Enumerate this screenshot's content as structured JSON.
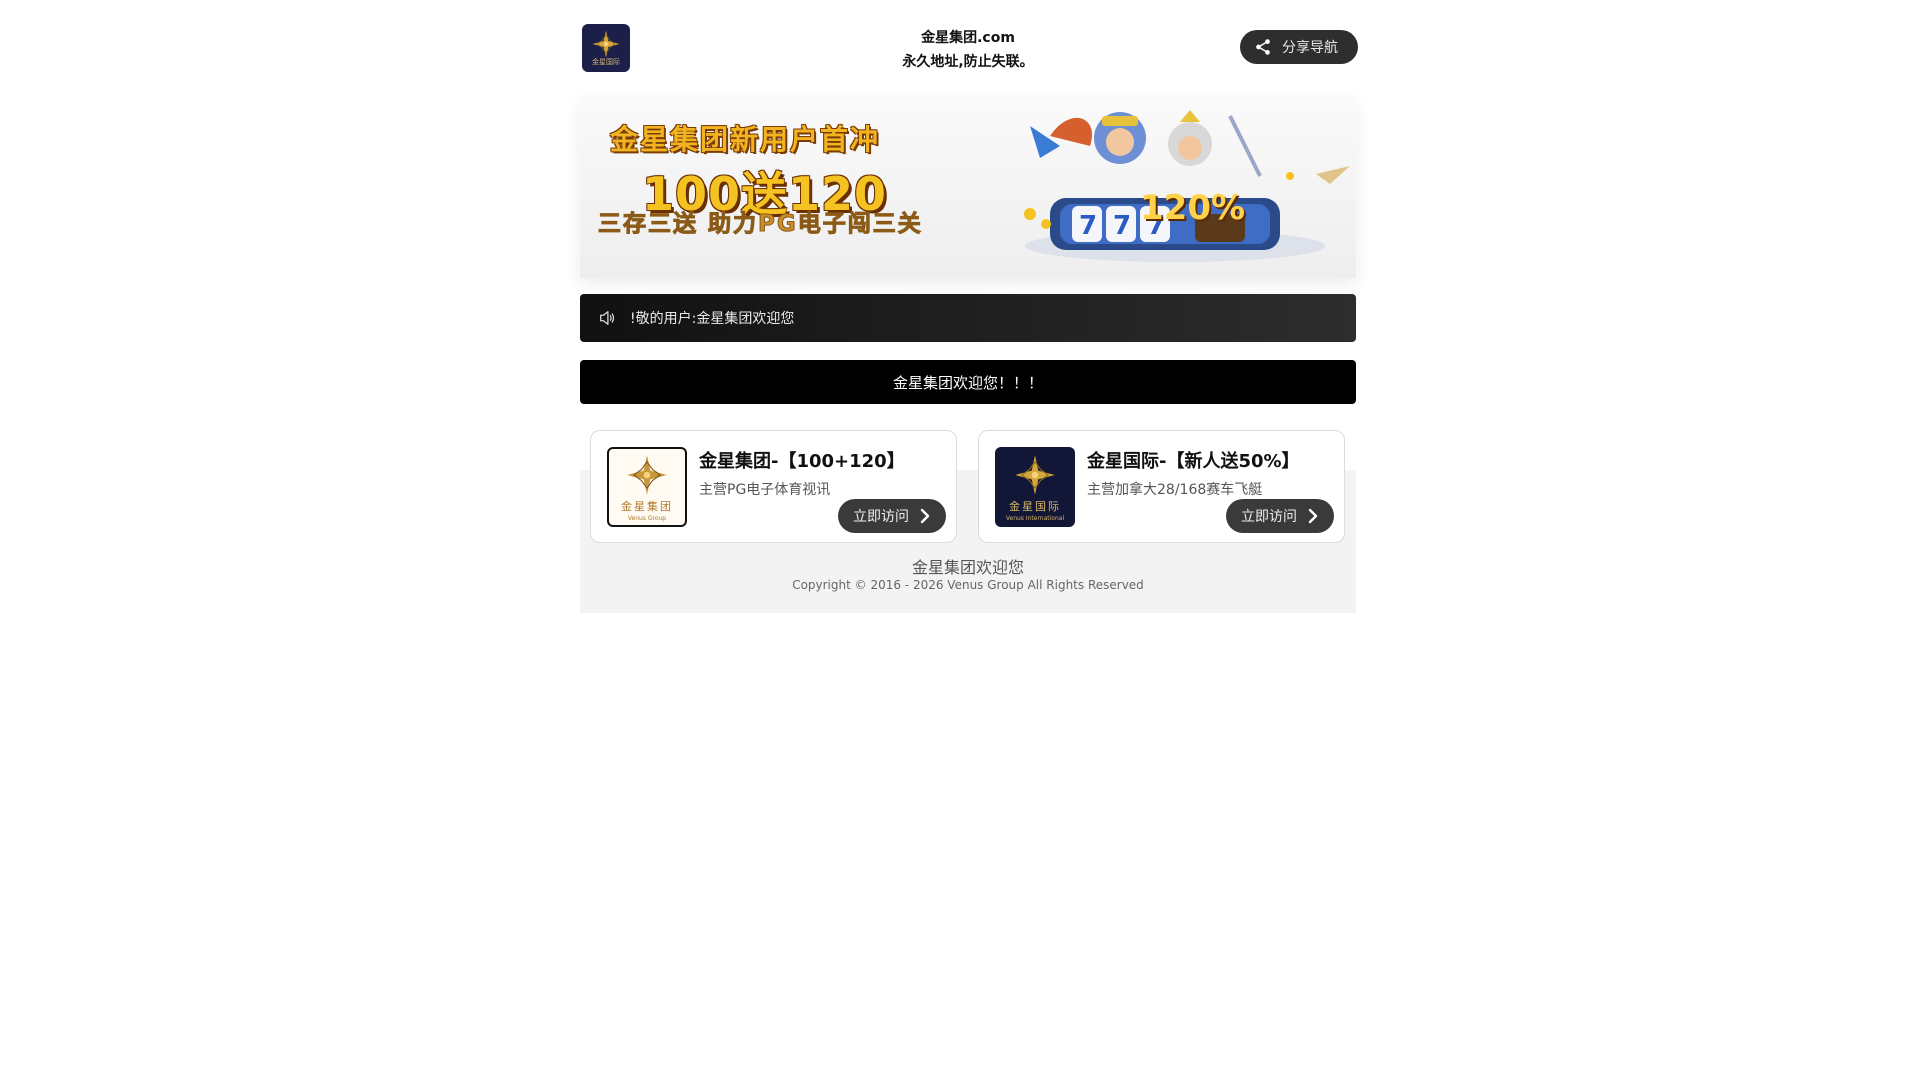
{
  "header": {
    "logo_caption": "金星国际",
    "title_line1": "金星集团.com",
    "title_line2": "永久地址,防止失联。",
    "share_label": "分享导航"
  },
  "banner": {
    "line1": "金星集团新用户首冲",
    "line2": "100送120",
    "line3": "三存三送 助力PG电子闯三关",
    "badge": "120%",
    "reels": "777"
  },
  "notice": {
    "icon": "speaker-icon",
    "text": "!敬的用户:金星集团欢迎您"
  },
  "welcome": {
    "text": "金星集团欢迎您！！！"
  },
  "cards": [
    {
      "title": "金星集团-【100+120】",
      "subtitle": "主营PG电子体育视讯",
      "logo_cn": "金星集团",
      "logo_en": "Venus Group",
      "button": "立即访问"
    },
    {
      "title": "金星国际-【新人送50%】",
      "subtitle": "主营加拿大28/168赛车飞艇",
      "logo_cn": "金星国际",
      "logo_en": "Venus International",
      "button": "立即访问"
    }
  ],
  "footer": {
    "welcome": "金星集团欢迎您",
    "copyright": "Copyright © 2016 - 2026 Venus Group All Rights Reserved"
  },
  "colors": {
    "gold": "#d6a63a",
    "dark": "#131737",
    "button": "#3a3a3a"
  }
}
